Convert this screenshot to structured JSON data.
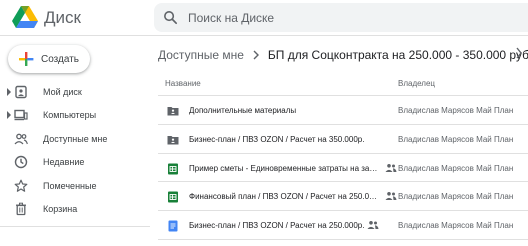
{
  "header": {
    "app_title": "Диск",
    "logo_icon": "google-drive-logo",
    "search": {
      "placeholder": "Поиск на Диске",
      "value": ""
    }
  },
  "sidebar": {
    "create_label": "Создать",
    "items": [
      {
        "label": "Мой диск",
        "icon": "my-drive-icon",
        "expandable": true
      },
      {
        "label": "Компьютеры",
        "icon": "computers-icon",
        "expandable": true
      },
      {
        "label": "Доступные мне",
        "icon": "shared-with-me-icon",
        "expandable": false
      },
      {
        "label": "Недавние",
        "icon": "clock-icon",
        "expandable": false
      },
      {
        "label": "Помеченные",
        "icon": "star-icon",
        "expandable": false
      },
      {
        "label": "Корзина",
        "icon": "trash-icon",
        "expandable": false
      }
    ]
  },
  "breadcrumb": {
    "root": "Доступные мне",
    "current": "БП для Соцконтракта на 250.000 - 350.000 руб."
  },
  "table": {
    "columns": {
      "name": "Название",
      "owner": "Владелец"
    },
    "rows": [
      {
        "name": "Дополнительные материалы",
        "type": "folder",
        "shared": false,
        "owner": "Владислав Марясов Май План"
      },
      {
        "name": "Бизнес-план / ПВЗ OZON / Расчет на 350.000р.",
        "type": "folder",
        "shared": false,
        "owner": "Владислав Марясов Май План"
      },
      {
        "name": "Пример сметы - Единовременные затраты на зап...",
        "type": "sheet",
        "shared": true,
        "owner": "Владислав Марясов Май План"
      },
      {
        "name": "Финансовый план / ПВЗ OZON / Расчет на 250.000...",
        "type": "sheet",
        "shared": true,
        "owner": "Владислав Марясов Май План"
      },
      {
        "name": "Бизнес-план / ПВЗ OZON / Расчет на 250.000р.",
        "type": "doc",
        "shared": true,
        "owner": "Владислав Марясов Май План"
      }
    ]
  },
  "colors": {
    "folder": "#5f6368",
    "sheet": "#188038",
    "doc": "#4285f4",
    "search_bg": "#f1f3f4"
  }
}
